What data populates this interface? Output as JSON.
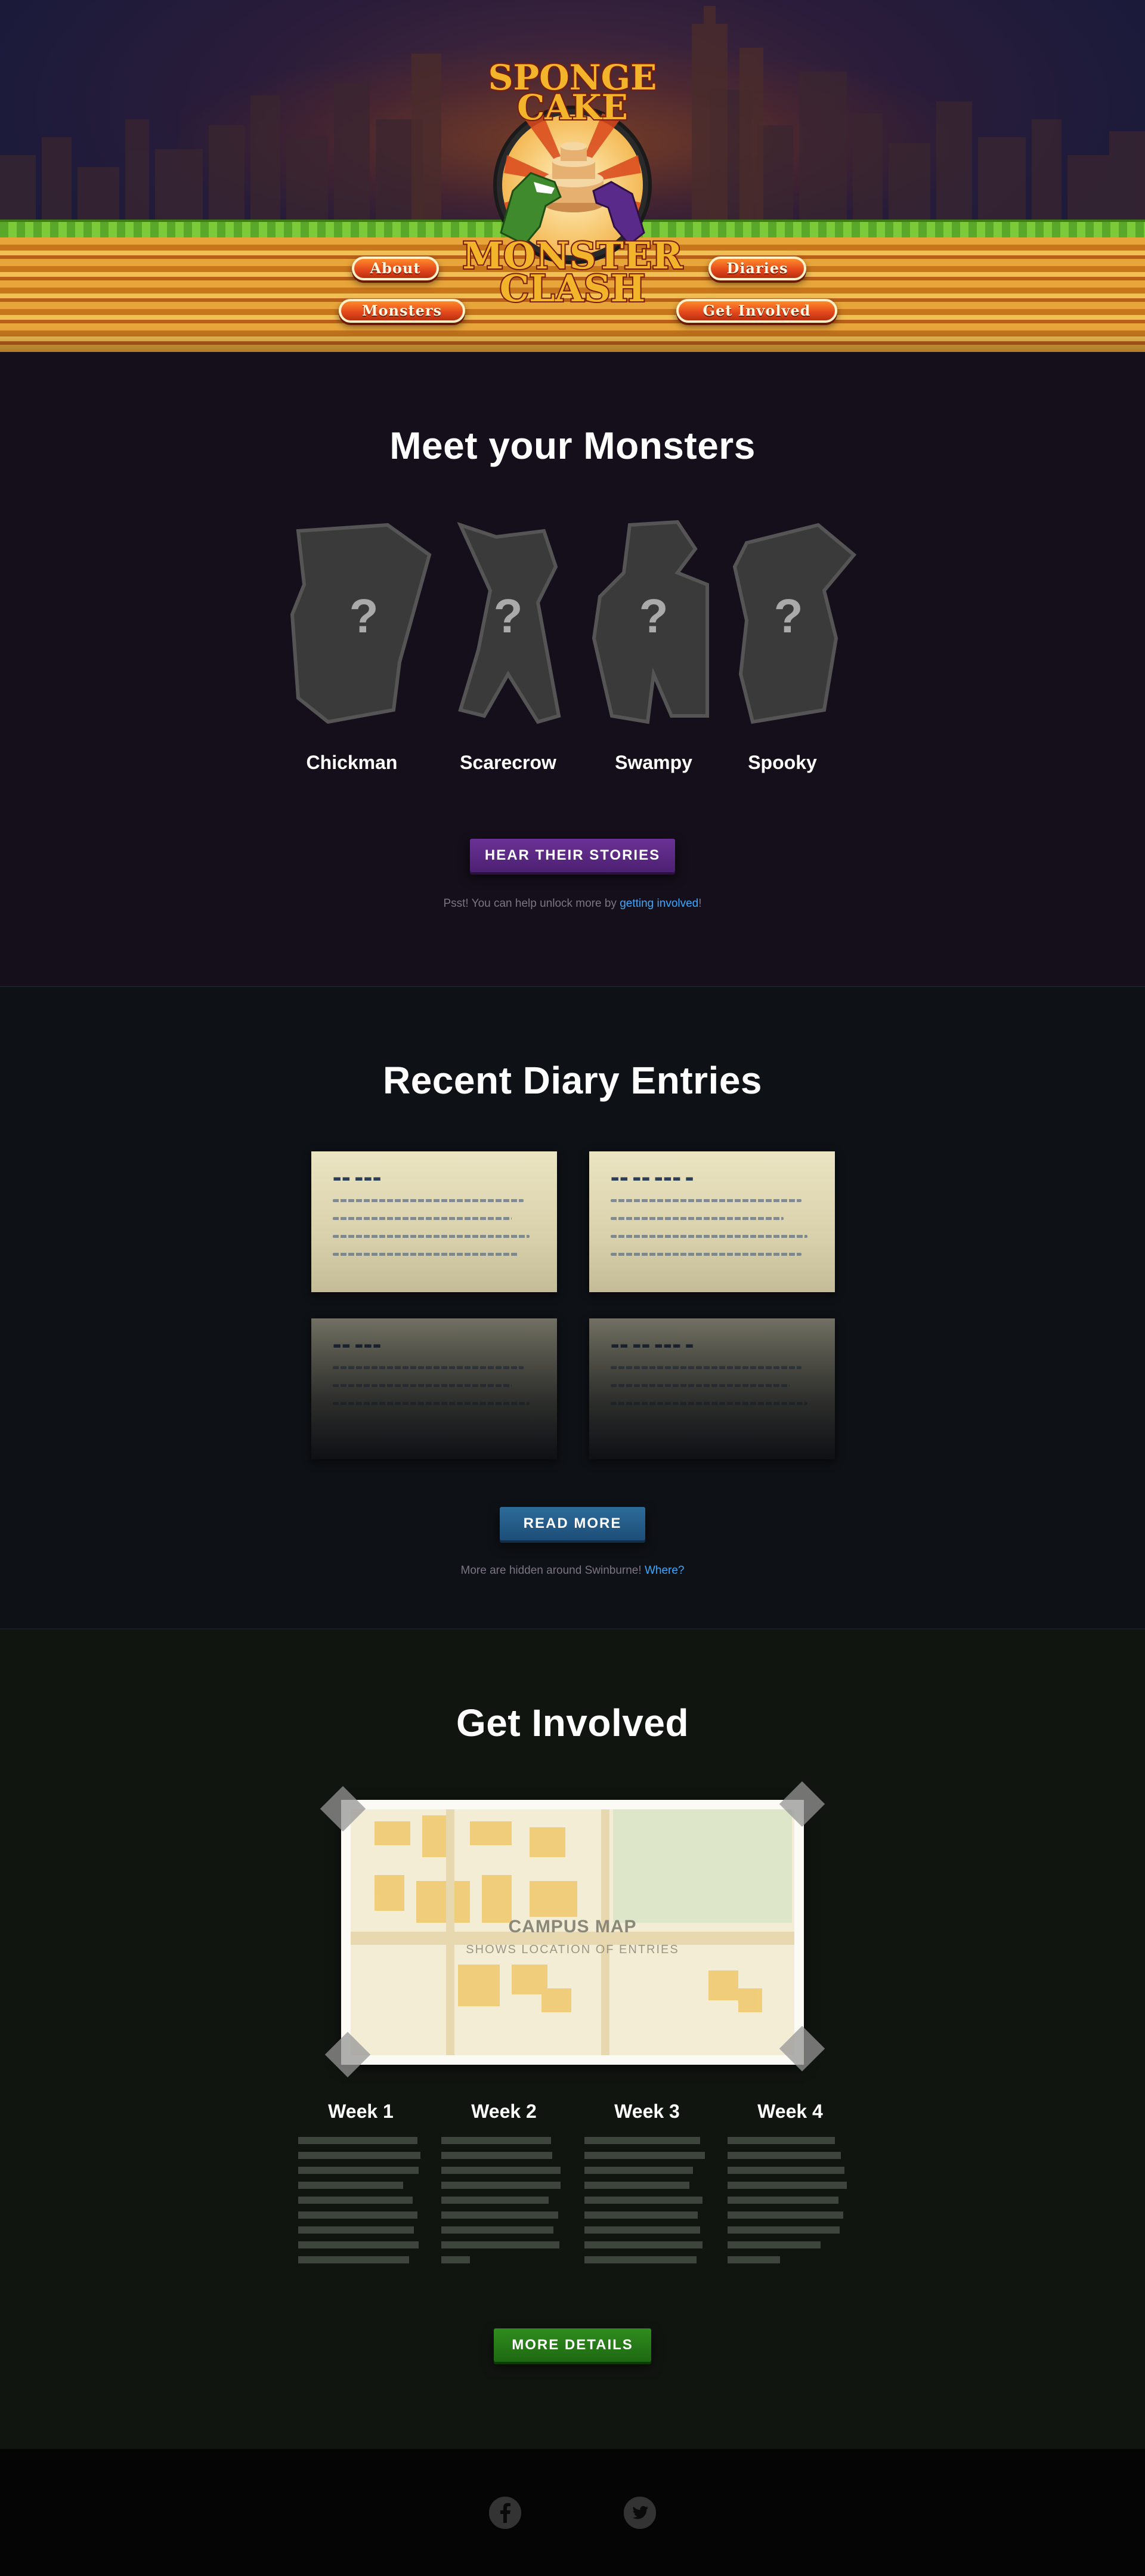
{
  "nav": {
    "about": "About",
    "monsters": "Monsters",
    "diaries": "Diaries",
    "get_involved": "Get Involved"
  },
  "logo": {
    "line1": "SPONGE",
    "line2": "CAKE",
    "line3": "MONSTER",
    "line4": "CLASH"
  },
  "monsters": {
    "title": "Meet your Monsters",
    "items": [
      {
        "name": "Chickman",
        "mark": "?"
      },
      {
        "name": "Scarecrow",
        "mark": "?"
      },
      {
        "name": "Swampy",
        "mark": "?"
      },
      {
        "name": "Spooky",
        "mark": "?"
      }
    ],
    "button": "HEAR THEIR STORIES",
    "note_prefix": "Psst! You can help unlock more by ",
    "note_link": "getting involved",
    "note_suffix": "!"
  },
  "diary": {
    "title": "Recent Diary Entries",
    "button": "READ MORE",
    "note_prefix": "More are hidden around Swinburne! ",
    "note_link": "Where?"
  },
  "involved": {
    "title": "Get Involved",
    "map_label": "CAMPUS MAP",
    "map_sub": "SHOWS LOCATION OF ENTRIES",
    "weeks": [
      "Week 1",
      "Week 2",
      "Week 3",
      "Week 4"
    ],
    "button": "MORE DETAILS"
  },
  "footer": {
    "icons": [
      "facebook-icon",
      "twitter-icon"
    ]
  },
  "colors": {
    "nav_button": "#e2461c",
    "monsters_button": "#5a2784",
    "read_button": "#24587f",
    "details_button": "#277a18",
    "link": "#3da8ff"
  }
}
